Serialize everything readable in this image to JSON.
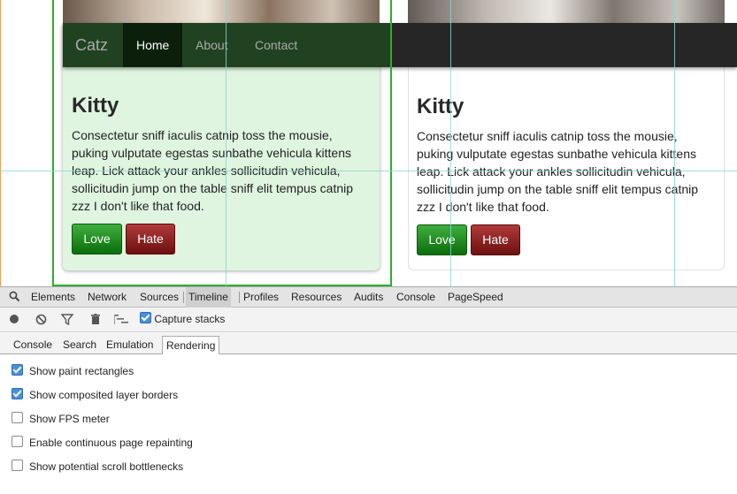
{
  "navbar": {
    "brand": "Catz",
    "items": [
      {
        "label": "Home",
        "active": true
      },
      {
        "label": "About",
        "active": false
      },
      {
        "label": "Contact",
        "active": false
      }
    ]
  },
  "cards": [
    {
      "title": "Kitty",
      "text": "Consectetur sniff iaculis catnip toss the mousie, puking vulputate egestas sunbathe vehicula kittens leap. Lick attack your ankles sollicitudin vehicula, sollicitudin jump on the table sniff elit tempus catnip zzz I don't like that food.",
      "love_label": "Love",
      "hate_label": "Hate"
    },
    {
      "title": "Kitty",
      "text": "Consectetur sniff iaculis catnip toss the mousie, puking vulputate egestas sunbathe vehicula kittens leap. Lick attack your ankles sollicitudin vehicula, sollicitudin jump on the table sniff elit tempus catnip zzz I don't like that food.",
      "love_label": "Love",
      "hate_label": "Hate"
    }
  ],
  "devtools": {
    "tabs": [
      "Elements",
      "Network",
      "Sources",
      "Timeline",
      "Profiles",
      "Resources",
      "Audits",
      "Console",
      "PageSpeed"
    ],
    "active_tab": "Timeline",
    "toolbar": {
      "icons": [
        "record-icon",
        "clear-icon",
        "filter-icon",
        "trash-icon",
        "flame-chart-icon"
      ],
      "capture_stacks_label": "Capture stacks",
      "capture_stacks_checked": true
    },
    "drawer_tabs": [
      "Console",
      "Search",
      "Emulation",
      "Rendering"
    ],
    "active_drawer_tab": "Rendering",
    "rendering_options": [
      {
        "label": "Show paint rectangles",
        "checked": true
      },
      {
        "label": "Show composited layer borders",
        "checked": true
      },
      {
        "label": "Show FPS meter",
        "checked": false
      },
      {
        "label": "Enable continuous page repainting",
        "checked": false
      },
      {
        "label": "Show potential scroll bottlenecks",
        "checked": false
      }
    ]
  },
  "colors": {
    "love": "#0b6e0b",
    "hate": "#6d1010",
    "navbar": "#262626",
    "card_highlight": "#dff5df",
    "paint_outline": "#2ab02a"
  }
}
